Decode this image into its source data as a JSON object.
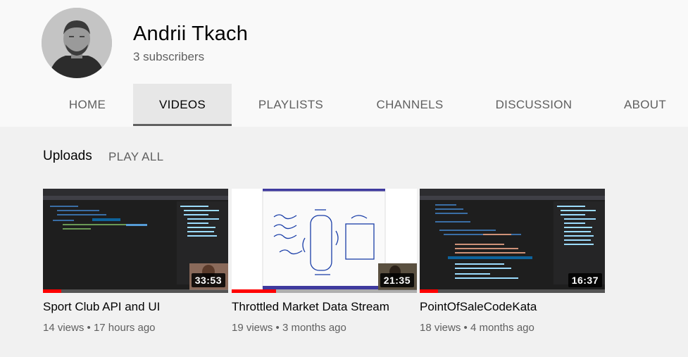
{
  "channel": {
    "name": "Andrii Tkach",
    "subscribers": "3 subscribers",
    "avatar_icon": "person-avatar-icon"
  },
  "tabs": [
    {
      "label": "HOME",
      "active": false
    },
    {
      "label": "VIDEOS",
      "active": true
    },
    {
      "label": "PLAYLISTS",
      "active": false
    },
    {
      "label": "CHANNELS",
      "active": false
    },
    {
      "label": "DISCUSSION",
      "active": false
    },
    {
      "label": "ABOUT",
      "active": false
    }
  ],
  "uploads": {
    "title": "Uploads",
    "play_all": "PLAY ALL"
  },
  "videos": [
    {
      "title": "Sport Club API and UI",
      "views": "14 views",
      "age": "17 hours ago",
      "duration": "33:53",
      "watched_fraction": 0.1
    },
    {
      "title": "Throttled Market Data Stream",
      "views": "19 views",
      "age": "3 months ago",
      "duration": "21:35",
      "watched_fraction": 0.24
    },
    {
      "title": "PointOfSaleCodeKata",
      "views": "18 views",
      "age": "4 months ago",
      "duration": "16:37",
      "watched_fraction": 0.1
    }
  ],
  "colors": {
    "accent_red": "#ff0000",
    "header_bg": "#f9f9f9",
    "page_bg": "#f1f1f1"
  }
}
